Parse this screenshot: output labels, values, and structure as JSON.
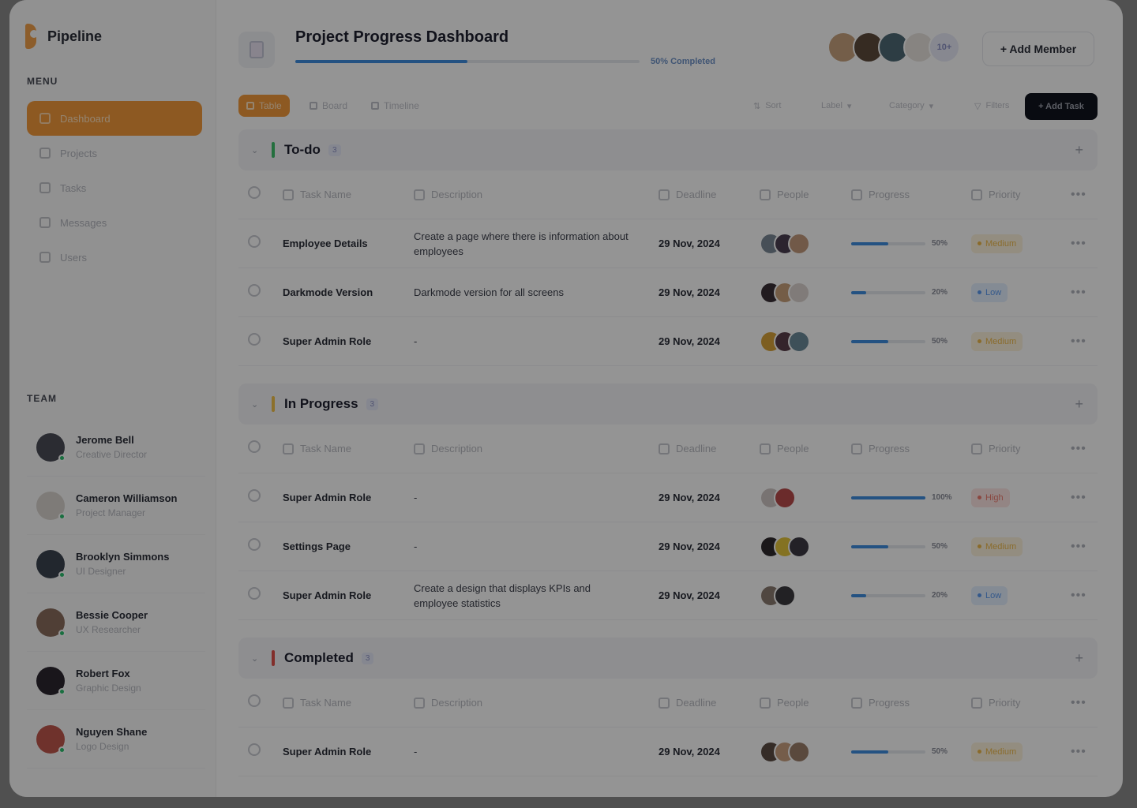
{
  "brand": {
    "name": "Pipeline",
    "accent": "#f39a3b"
  },
  "sidebar": {
    "menu_label": "MENU",
    "items": [
      {
        "label": "Dashboard",
        "icon": "grid-icon",
        "active": true
      },
      {
        "label": "Projects",
        "icon": "calendar-icon"
      },
      {
        "label": "Tasks",
        "icon": "clipboard-icon"
      },
      {
        "label": "Messages",
        "icon": "message-icon"
      },
      {
        "label": "Users",
        "icon": "user-icon"
      }
    ],
    "team_label": "TEAM",
    "team": [
      {
        "name": "Jerome Bell",
        "role": "Creative Director",
        "color": "#4a4d57"
      },
      {
        "name": "Cameron Williamson",
        "role": "Project Manager",
        "color": "#d9d4cf"
      },
      {
        "name": "Brooklyn Simmons",
        "role": "UI Designer",
        "color": "#3b4450"
      },
      {
        "name": "Bessie Cooper",
        "role": "UX Researcher",
        "color": "#8a6d5e"
      },
      {
        "name": "Robert Fox",
        "role": "Graphic Design",
        "color": "#2b2630"
      },
      {
        "name": "Nguyen Shane",
        "role": "Logo Design",
        "color": "#c0574d"
      }
    ]
  },
  "header": {
    "title": "Project Progress Dashboard",
    "progress_label": "50% Completed",
    "progress": 0.5,
    "member_colors": [
      "#c9a37e",
      "#5d4a3c",
      "#4f6a76",
      "#e9e4df"
    ],
    "more_label": "10+",
    "add_member": "+ Add Member"
  },
  "toolbar": {
    "views": [
      "Table",
      "Board",
      "Timeline"
    ],
    "tools": [
      "Sort",
      "Label",
      "Category",
      "Filters"
    ],
    "add_task": "+ Add Task"
  },
  "columns": [
    "Task Name",
    "Description",
    "Deadline",
    "People",
    "Progress",
    "Priority"
  ],
  "groups": [
    {
      "title": "To-do",
      "count": "3",
      "bar_color": "#3fbf6b",
      "rows": [
        {
          "name": "Employee Details",
          "desc": "Create a page where there is information about employees",
          "deadline": "29 Nov, 2024",
          "people": [
            "#7a8896",
            "#4b3f52",
            "#c39a7c"
          ],
          "progress": 0.5,
          "progress_label": "50%",
          "priority": "Medium"
        },
        {
          "name": "Darkmode Version",
          "desc": "Darkmode version for all screens",
          "deadline": "29 Nov, 2024",
          "people": [
            "#3a3036",
            "#c8a07a",
            "#ddd5d0"
          ],
          "progress": 0.2,
          "progress_label": "20%",
          "priority": "Low"
        },
        {
          "name": "Super Admin Role",
          "desc": "-",
          "deadline": "29 Nov, 2024",
          "people": [
            "#d8a33a",
            "#5b3e4a",
            "#6c8a9a"
          ],
          "progress": 0.5,
          "progress_label": "50%",
          "priority": "Medium"
        }
      ]
    },
    {
      "title": "In Progress",
      "count": "3",
      "bar_color": "#f2c14a",
      "rows": [
        {
          "name": "Super Admin Role",
          "desc": "-",
          "deadline": "29 Nov, 2024",
          "people": [
            "#cfc7c4",
            "#b84a4a"
          ],
          "progress": 1.0,
          "progress_label": "100%",
          "priority": "High"
        },
        {
          "name": "Settings Page",
          "desc": "-",
          "deadline": "29 Nov, 2024",
          "people": [
            "#2f2a2e",
            "#e3c43c",
            "#3d3a44"
          ],
          "progress": 0.5,
          "progress_label": "50%",
          "priority": "Medium"
        },
        {
          "name": "Super Admin Role",
          "desc": "Create a design that displays KPIs and employee statistics",
          "deadline": "29 Nov, 2024",
          "people": [
            "#8b7a70",
            "#3c3a3f"
          ],
          "progress": 0.2,
          "progress_label": "20%",
          "priority": "Low"
        }
      ]
    },
    {
      "title": "Completed",
      "count": "3",
      "bar_color": "#e0504a",
      "rows": [
        {
          "name": "Super Admin Role",
          "desc": "-",
          "deadline": "29 Nov, 2024",
          "people": [
            "#5c4c44",
            "#caa080",
            "#9b7e6a"
          ],
          "progress": 0.5,
          "progress_label": "50%",
          "priority": "Medium"
        }
      ]
    }
  ]
}
